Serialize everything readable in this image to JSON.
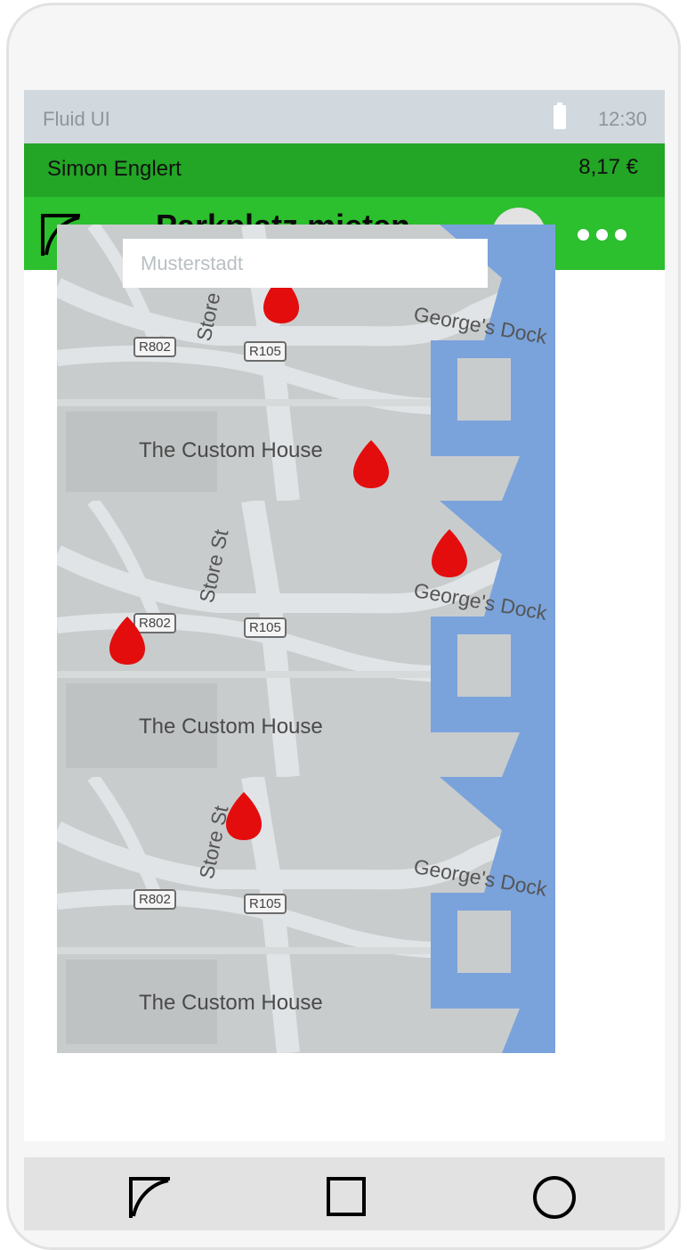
{
  "statusbar": {
    "app_name": "Fluid UI",
    "time": "12:30",
    "battery_icon": "battery-icon"
  },
  "user": {
    "name": "Simon Englert",
    "balance": "8,17 €"
  },
  "header": {
    "title": "Parkplatz mieten",
    "logo_icon": "app-logo-icon",
    "avatar_icon": "avatar",
    "menu_icon": "more-dots-icon"
  },
  "search": {
    "placeholder": "Musterstadt",
    "value": ""
  },
  "map": {
    "tiles": [
      {
        "labels": {
          "poi": "The Custom House",
          "dock": "George's Dock",
          "street": "Store",
          "road1": "R802",
          "road2": "R105"
        }
      },
      {
        "labels": {
          "poi": "The Custom House",
          "dock": "George's Dock",
          "street": "Store St",
          "road1": "R802",
          "road2": "R105"
        }
      },
      {
        "labels": {
          "poi": "The Custom House",
          "dock": "George's Dock",
          "street": "Store St",
          "road1": "R802",
          "road2": "R105"
        }
      }
    ],
    "pin_color": "#e30d0d",
    "water_color": "#7aa3dc"
  },
  "navbar": {
    "back_icon": "back-icon",
    "home_icon": "square-icon",
    "recents_icon": "circle-icon"
  }
}
